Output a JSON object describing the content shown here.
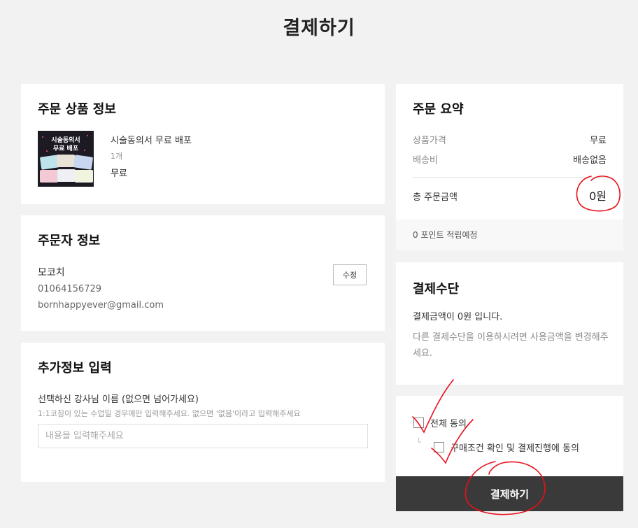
{
  "page": {
    "title": "결제하기"
  },
  "order_product": {
    "title": "주문 상품 정보",
    "thumbnail_text": [
      "시술동의서",
      "무료 배포"
    ],
    "name": "시술동의서 무료 배포",
    "quantity": "1개",
    "price": "무료"
  },
  "orderer": {
    "title": "주문자 정보",
    "name": "모코치",
    "phone": "01064156729",
    "email": "bornhappyever@gmail.com",
    "edit_label": "수정"
  },
  "extra_info": {
    "title": "추가정보 입력",
    "field_label": "선택하신 강사님 이름 (없으면 넘어가세요)",
    "field_help": "1:1코칭이 있는 수업일 경우에만 입력해주세요. 없으면 '없음'이라고 입력해주세요",
    "input_placeholder": "내용을 입력해주세요",
    "input_value": ""
  },
  "order_summary": {
    "title": "주문 요약",
    "product_price_label": "상품가격",
    "product_price_value": "무료",
    "shipping_label": "배송비",
    "shipping_value": "배송없음",
    "total_label": "총 주문금액",
    "total_value": "0원",
    "points_note": "0 포인트 적립예정"
  },
  "payment_method": {
    "title": "결제수단",
    "amount_text": "결제금액이 0원 입니다.",
    "note": "다른 결제수단을 이용하시려면 사용금액을 변경해주세요."
  },
  "agreement": {
    "all_label": "전체 동의",
    "terms_label": "구매조건 확인 및 결제진행에 동의",
    "all_checked": false,
    "terms_checked": false
  },
  "pay_button": {
    "label": "결제하기"
  },
  "colors": {
    "background": "#f2f2f2",
    "card": "#ffffff",
    "pay_button": "#3a3a3a",
    "annotation": "#e8101c"
  },
  "icons": [
    "checkbox-icon",
    "indent-corner-icon"
  ]
}
